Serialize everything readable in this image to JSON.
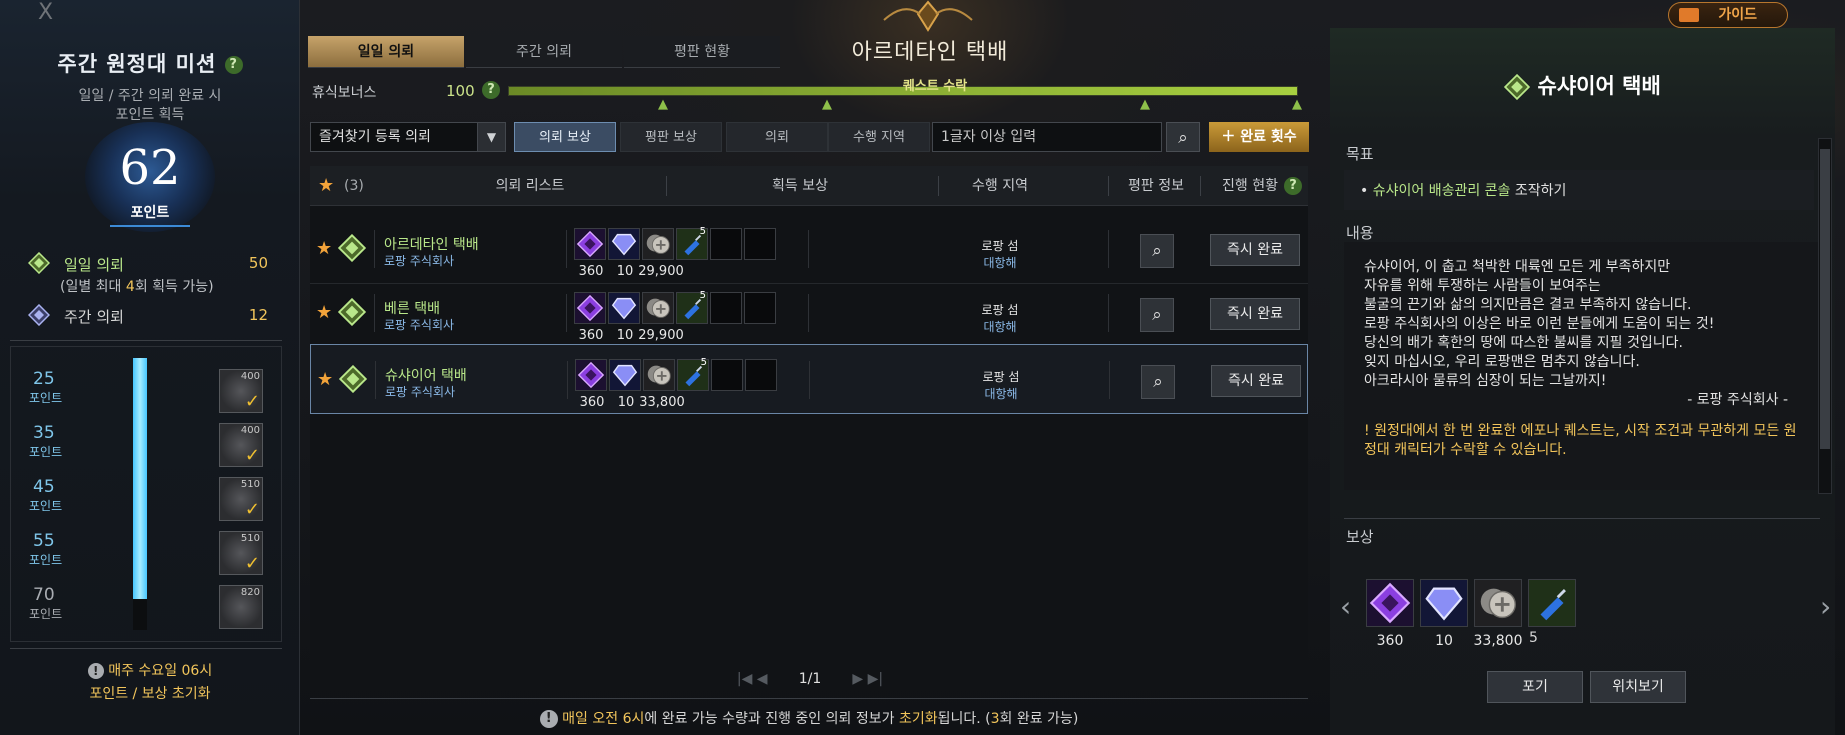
{
  "window": {
    "close": "X"
  },
  "guide_button": "가이드",
  "left": {
    "title": "주간 원정대 미션",
    "sub1": "일일 / 주간 의뢰 완료 시",
    "sub2": "포인트 획득",
    "points": "62",
    "points_label": "포인트",
    "daily_label": "일일 의뢰",
    "daily_value": "50",
    "daily_note_a": "(일별 최대 ",
    "daily_note_b": "4",
    "daily_note_c": "회 획득 가능)",
    "weekly_label": "주간 의뢰",
    "weekly_value": "12",
    "tiers": [
      {
        "points": "25",
        "unit": "포인트",
        "qty": "400",
        "claimed": true
      },
      {
        "points": "35",
        "unit": "포인트",
        "qty": "400",
        "claimed": true
      },
      {
        "points": "45",
        "unit": "포인트",
        "qty": "510",
        "claimed": true
      },
      {
        "points": "55",
        "unit": "포인트",
        "qty": "510",
        "claimed": true
      },
      {
        "points": "70",
        "unit": "포인트",
        "qty": "820",
        "claimed": false
      }
    ],
    "progress_fraction": 0.886,
    "reset_line1": "매주 수요일 06시",
    "reset_line2": "포인트 / 보상 초기화"
  },
  "tabs": [
    "일일 의뢰",
    "주간 의뢰",
    "평판 현황"
  ],
  "title": "아르데타인 택배",
  "rest": {
    "label": "휴식보너스",
    "value": "100",
    "fraction": 1.0,
    "quest_accept": "퀘스트 수락"
  },
  "filter": {
    "dropdown": "즐겨찾기 등록 의뢰",
    "buttons": [
      "의뢰 보상",
      "평판 보상",
      "의뢰",
      "수행 지역"
    ],
    "placeholder": "1글자 이상 입력",
    "complete_count": "완료 횟수"
  },
  "table": {
    "favorite_count": "(3)",
    "headers": {
      "list": "의뢰 리스트",
      "reward": "획득 보상",
      "region": "수행 지역",
      "rep": "평판 정보",
      "progress": "진행 현황"
    },
    "rows": [
      {
        "name": "아르데타인 택배",
        "company": "로팡 주식회사",
        "r1": "360",
        "r2": "10",
        "r3": "29,900",
        "r4_sup": "5",
        "region": "로팡 섬",
        "sea": "대항해",
        "action": "즉시 완료"
      },
      {
        "name": "베른 택배",
        "company": "로팡 주식회사",
        "r1": "360",
        "r2": "10",
        "r3": "29,900",
        "r4_sup": "5",
        "region": "로팡 섬",
        "sea": "대항해",
        "action": "즉시 완료"
      },
      {
        "name": "슈샤이어 택배",
        "company": "로팡 주식회사",
        "r1": "360",
        "r2": "10",
        "r3": "33,800",
        "r4_sup": "5",
        "region": "로팡 섬",
        "sea": "대항해",
        "action": "즉시 완료"
      }
    ]
  },
  "pager": "1/1",
  "footnote": {
    "a": "매일 오전 6시",
    "b": "에 완료 가능 수량과 진행 중인 의뢰 정보가 ",
    "c": "초기화",
    "d": "됩니다. (",
    "e": "3",
    "f": "회 완료 가능)"
  },
  "right": {
    "title": "슈샤이어 택배",
    "goal_label": "목표",
    "goal_item": "슈샤이어 배송관리 콘솔",
    "goal_suffix": " 조작하기",
    "content_label": "내용",
    "content_lines": [
      "슈샤이어, 이 춥고 척박한 대륙엔 모든 게 부족하지만",
      "자유를 위해 투쟁하는 사람들이 보여주는",
      "불굴의 끈기와 삶의 의지만큼은 결코 부족하지 않습니다.",
      "로팡 주식회사의 이상은 바로 이런 분들에게 도움이 되는 것!",
      "당신의 배가 혹한의 땅에 따스한 불씨를 지필 것입니다.",
      "잊지 마십시오, 우리 로팡맨은 멈추지 않습니다.",
      "아크라시아 물류의 심장이 되는 그날까지!"
    ],
    "signature": "- 로팡 주식회사 -",
    "warning": "! 원정대에서 한 번 완료한 에포나 퀘스트는, 시작 조건과 무관하게 모든 원정대 캐릭터가 수락할 수 있습니다.",
    "reward_label": "보상",
    "rewards": [
      "360",
      "10",
      "33,800"
    ],
    "reward_sup": "5",
    "giveup": "포기",
    "locate": "위치보기"
  },
  "colors": {
    "accent_gold": "#f2c55b",
    "quest_green": "#b9e78a",
    "company_blue": "#8ab8e6"
  }
}
